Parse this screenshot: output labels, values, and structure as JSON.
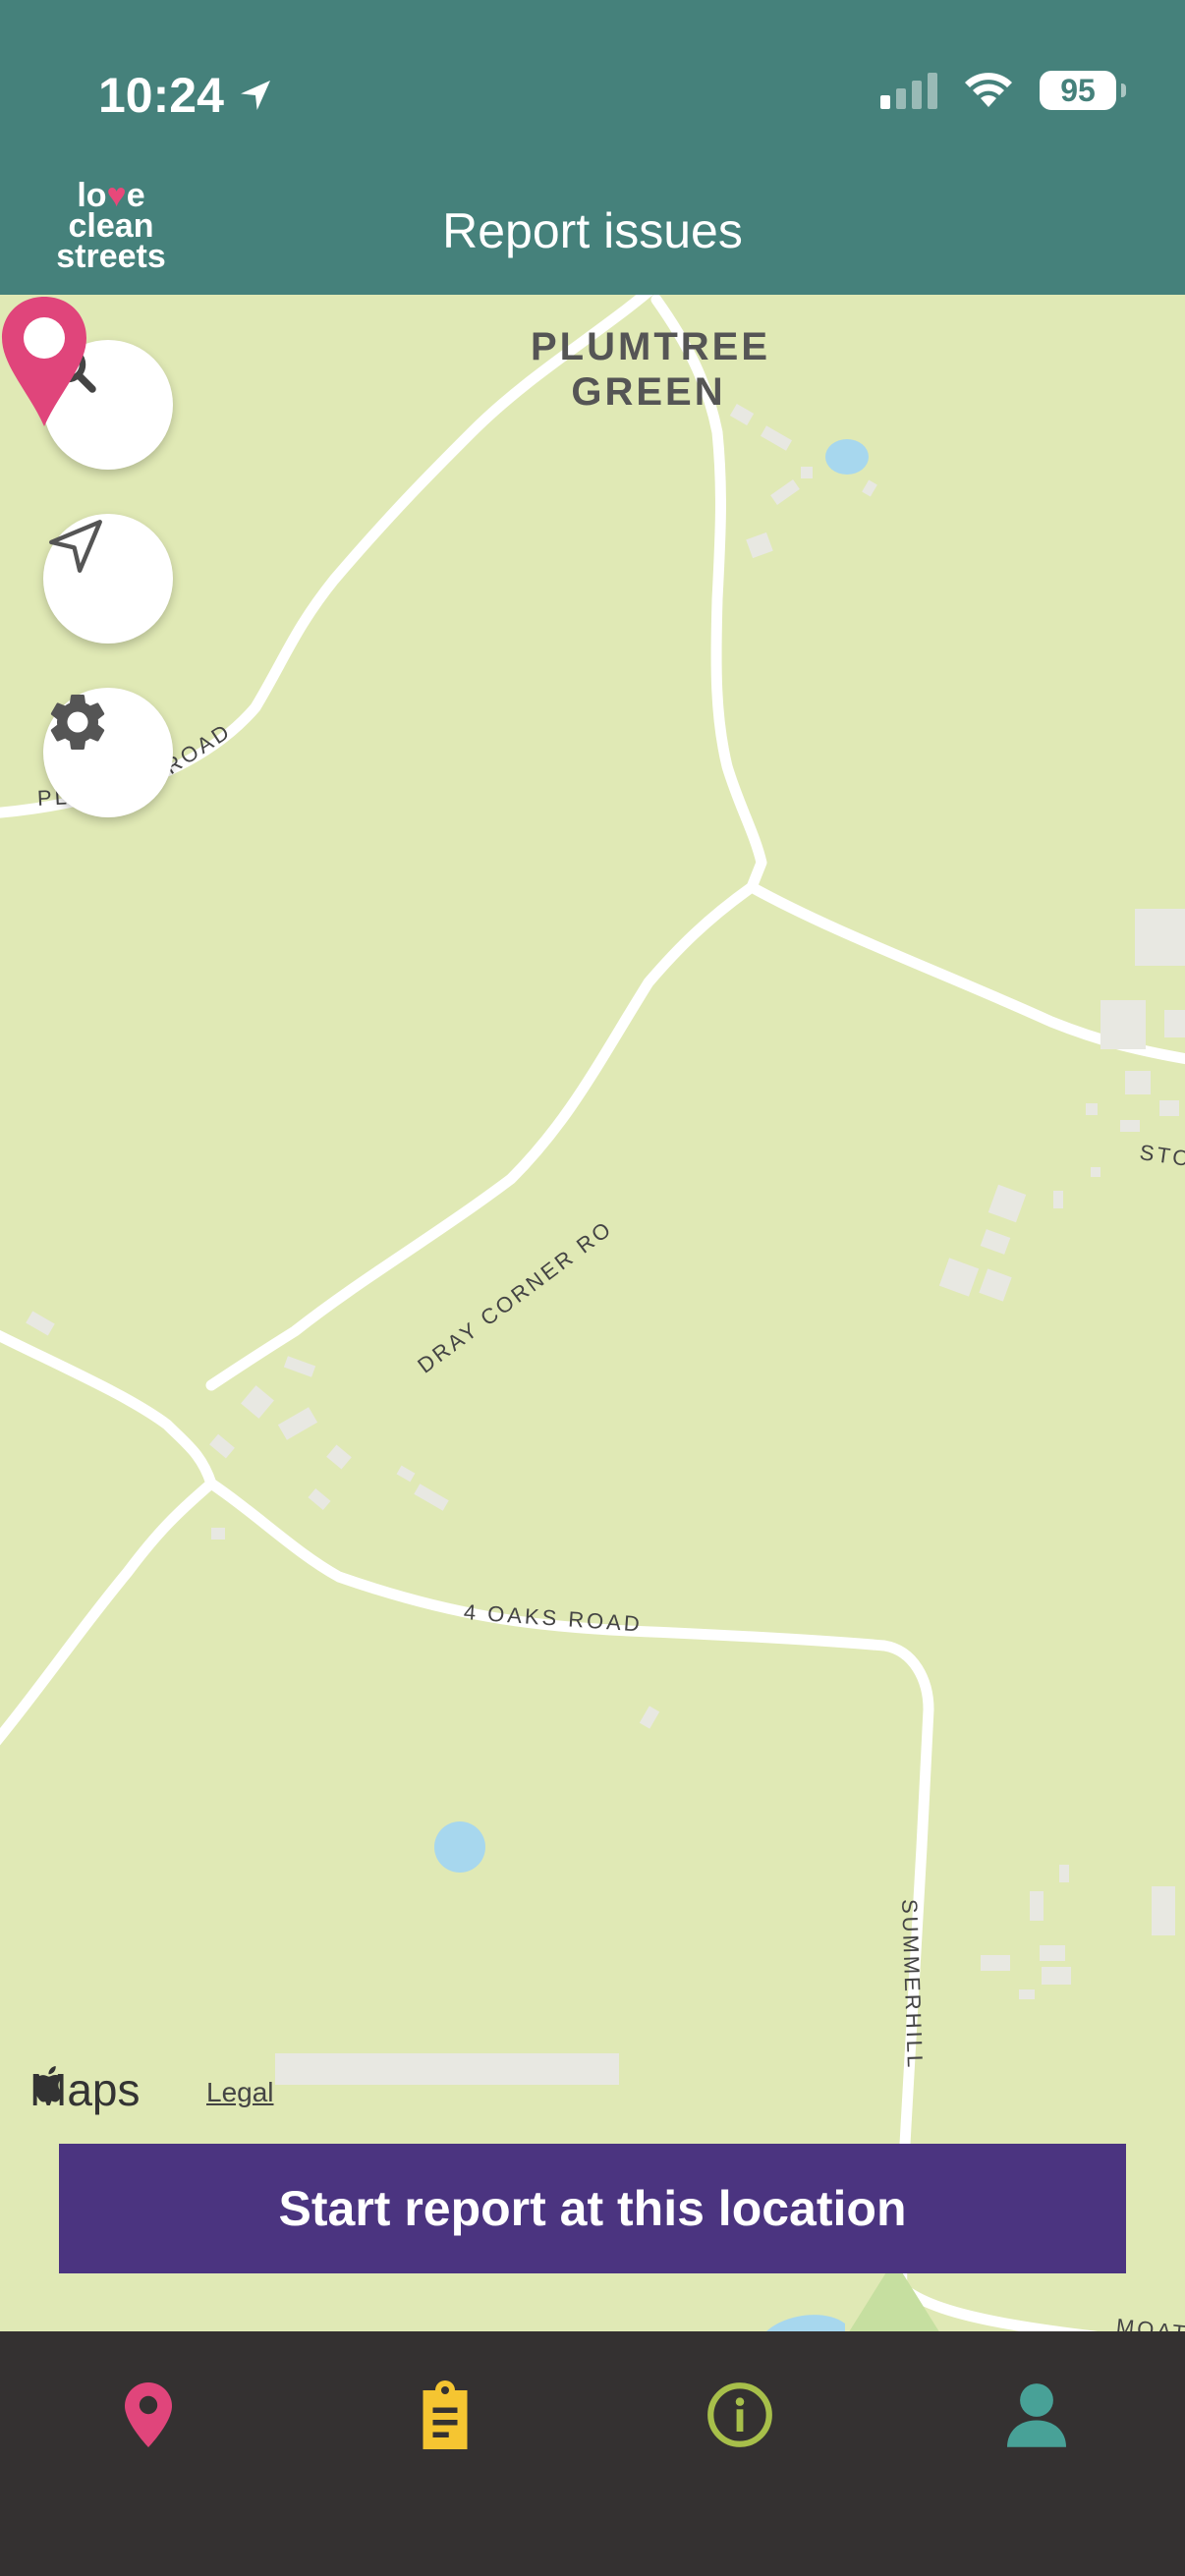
{
  "status_bar": {
    "time": "10:24",
    "battery": "95"
  },
  "header": {
    "title": "Report issues",
    "logo_lines": [
      "love",
      "clean",
      "streets"
    ]
  },
  "map": {
    "place_label": [
      "PLUMTREE",
      "GREEN"
    ],
    "road_labels": {
      "plumtree_road_left": "PL",
      "plumtree_road_right": "ROAD",
      "dray_corner": "DRAY CORNER RO",
      "four_oaks": "4 OAKS ROAD",
      "summerhill": "SUMMERHILL",
      "east_edge": "STO",
      "moat_edge": "MOAT"
    },
    "credit": "Maps",
    "legal": "Legal"
  },
  "controls": {
    "search": "search-icon",
    "locate": "location-arrow-icon",
    "settings": "gear-icon"
  },
  "cta": {
    "label": "Start report at this location"
  },
  "tabs": [
    {
      "name": "map",
      "icon": "map-pin-icon",
      "color": "#e0457b"
    },
    {
      "name": "reports",
      "icon": "clipboard-icon",
      "color": "#f5c531"
    },
    {
      "name": "info",
      "icon": "info-icon",
      "color": "#a7bf4a"
    },
    {
      "name": "profile",
      "icon": "person-icon",
      "color": "#48a197"
    }
  ],
  "colors": {
    "header": "#45817b",
    "map_land": "#e0e9b5",
    "cta": "#4b3480",
    "pin": "#e0457b",
    "tabbar": "#343131"
  }
}
